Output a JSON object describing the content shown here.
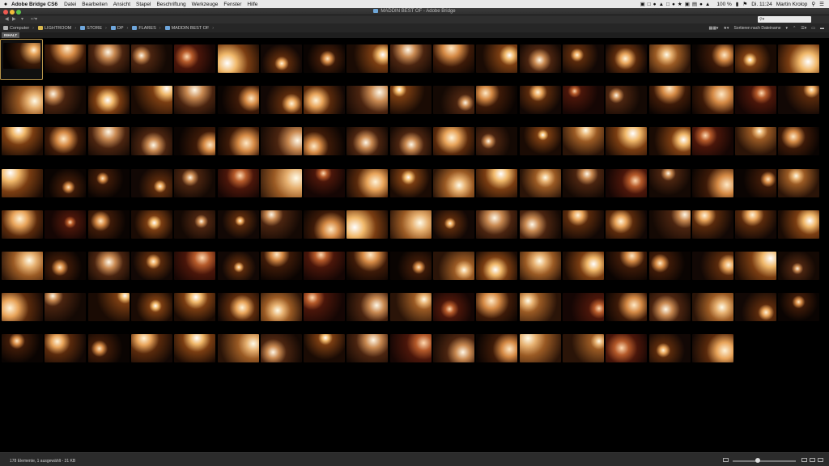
{
  "menubar": {
    "apple": "",
    "app_name": "Adobe Bridge CS6",
    "items": [
      "Datei",
      "Bearbeiten",
      "Ansicht",
      "Stapel",
      "Beschriftung",
      "Werkzeuge",
      "Fenster",
      "Hilfe"
    ],
    "battery": "100 %",
    "clock": "Di. 11:24",
    "user": "Martin Krolop"
  },
  "window": {
    "title": "MADDIN BEST OF - Adobe Bridge"
  },
  "toolbar": {
    "search_placeholder": ""
  },
  "breadcrumb": [
    "Computer",
    "LIGHTROOM",
    "STORE",
    "DP",
    "FLARES",
    "MADDIN BEST OF"
  ],
  "view": {
    "sort_label": "Sortieren nach Dateiname"
  },
  "content_tab": "INHALT",
  "status": {
    "text": "178 Elemente, 1 ausgewählt - 31 KB"
  },
  "colors": {
    "accent": "#c9a24a",
    "background": "#000000",
    "chrome": "#2f2f2f"
  },
  "thumbnails_shown": 150
}
